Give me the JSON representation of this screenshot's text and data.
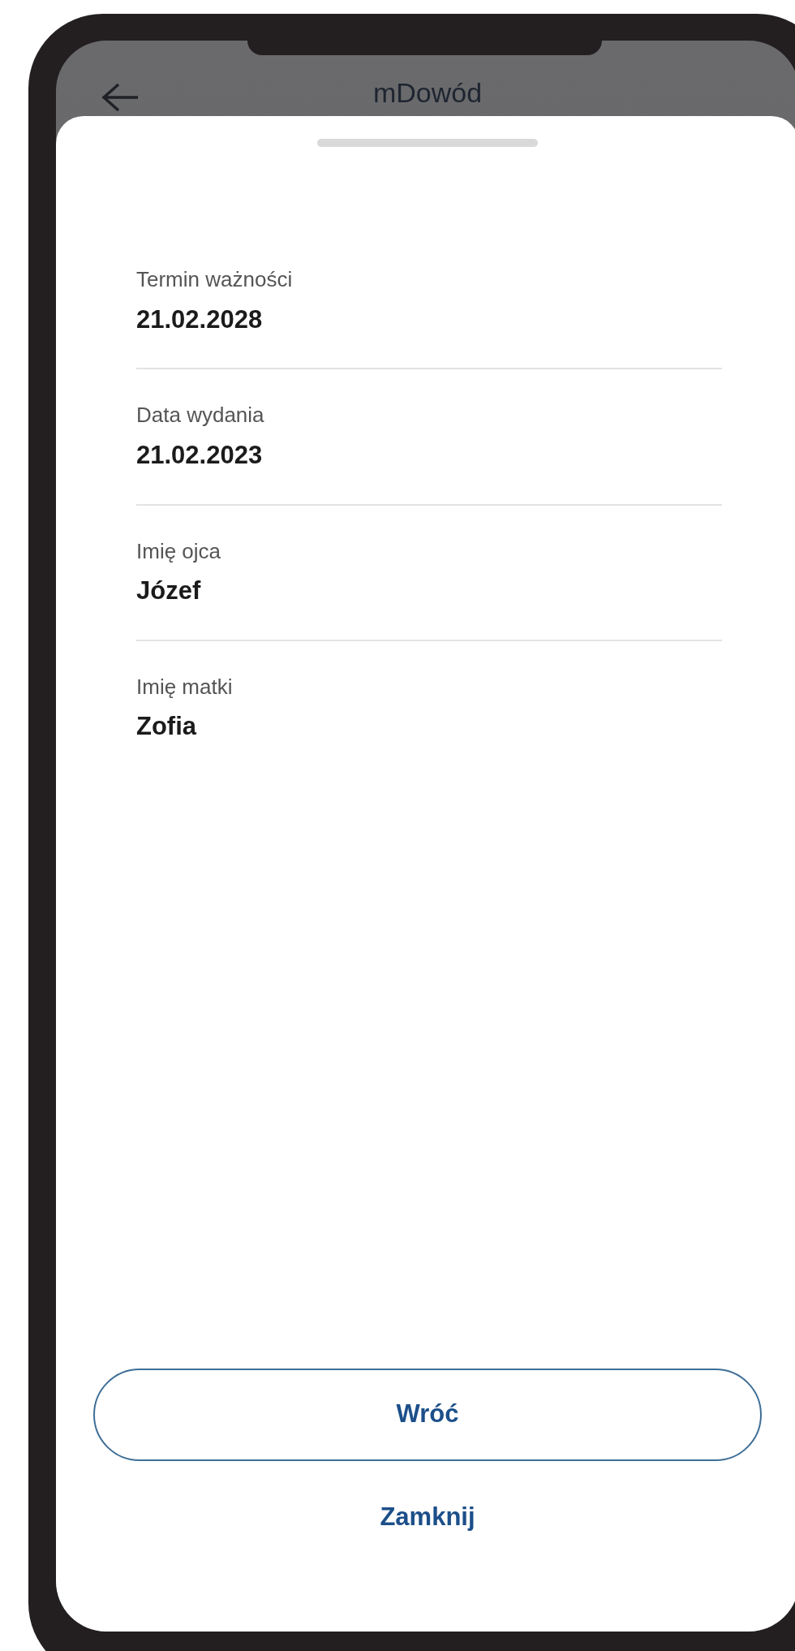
{
  "header": {
    "title": "mDowód"
  },
  "fields": [
    {
      "label": "Termin ważności",
      "value": "21.02.2028"
    },
    {
      "label": "Data wydania",
      "value": "21.02.2023"
    },
    {
      "label": "Imię ojca",
      "value": "Józef"
    },
    {
      "label": "Imię matki",
      "value": "Zofia"
    }
  ],
  "buttons": [
    {
      "kind": "outlined",
      "label": "Wróć"
    },
    {
      "kind": "text",
      "label": "Zamknij"
    }
  ]
}
